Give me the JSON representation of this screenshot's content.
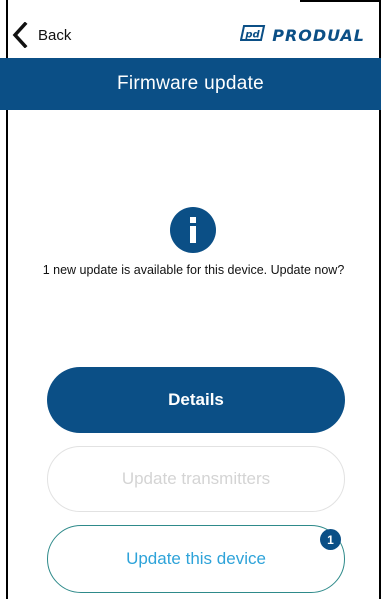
{
  "header": {
    "back_label": "Back",
    "logo_text": "PRODUAL",
    "logo_mark": "pd"
  },
  "title": "Firmware update",
  "info": {
    "icon": "info-icon",
    "message": "1 new update is available for this device. Update now?"
  },
  "buttons": {
    "details": "Details",
    "update_transmitters": "Update transmitters",
    "update_device": "Update this device",
    "update_device_badge": "1"
  },
  "colors": {
    "brand_blue": "#0b4f86",
    "disabled_text": "#d4d4d4",
    "device_button_text": "#2ea3d9",
    "device_button_border": "#2e8a8a"
  }
}
